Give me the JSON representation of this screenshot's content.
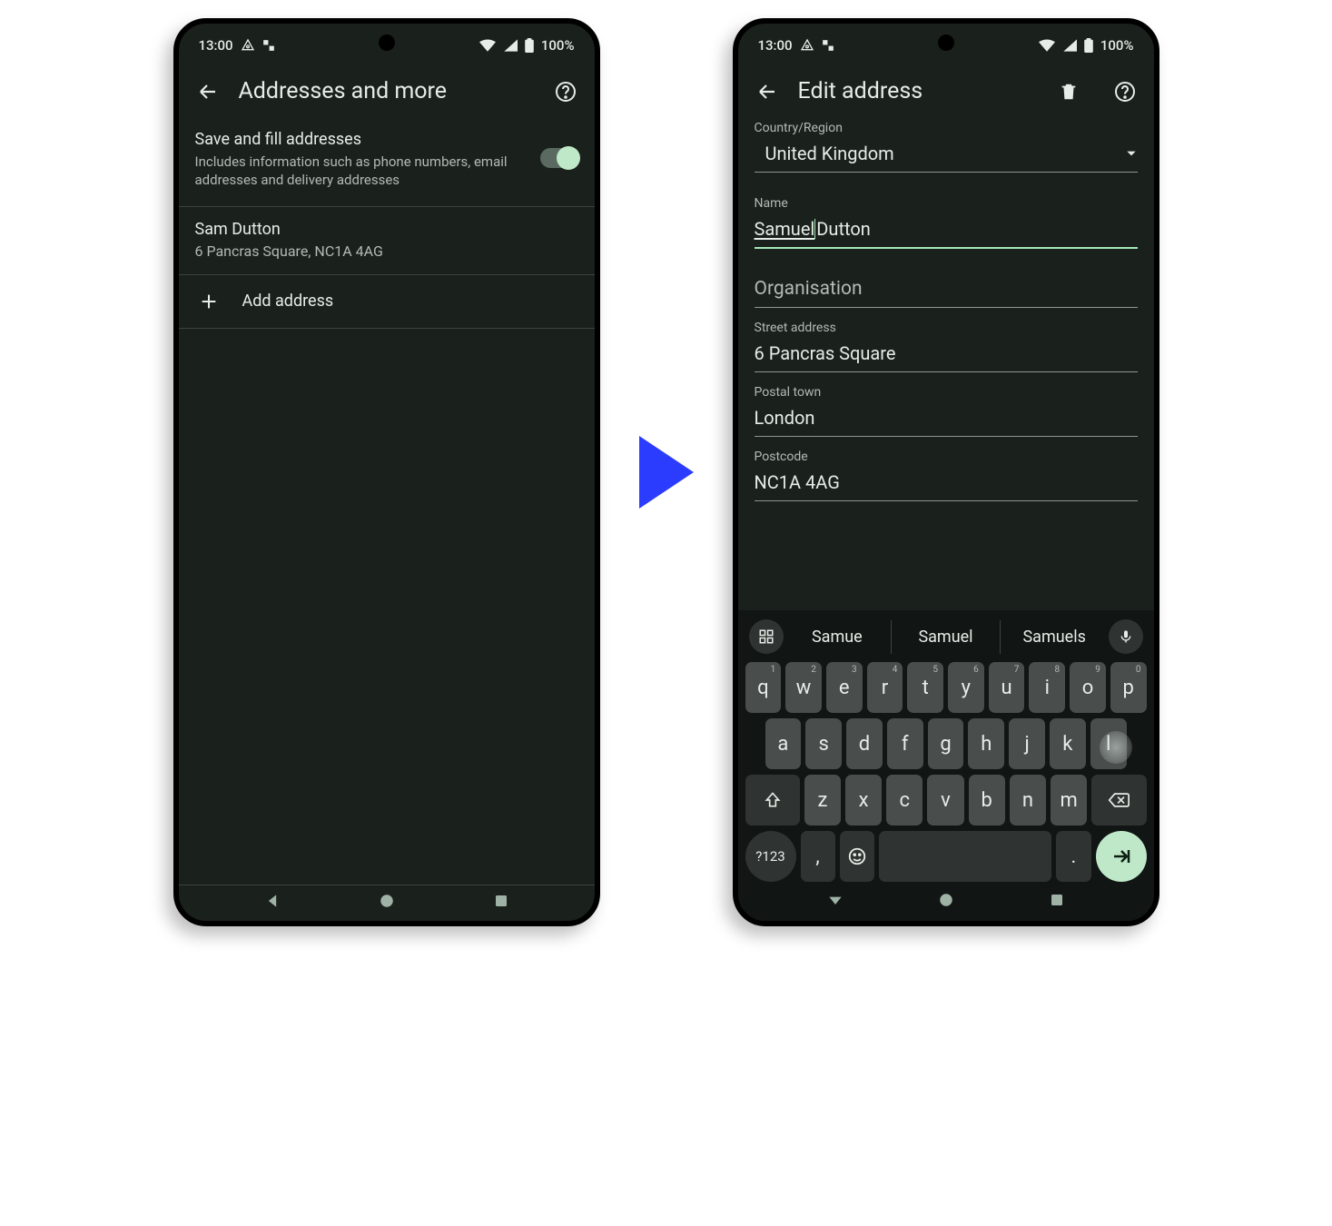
{
  "status": {
    "time": "13:00",
    "battery": "100%"
  },
  "left": {
    "title": "Addresses and more",
    "toggle_title": "Save and fill addresses",
    "toggle_sub": "Includes information such as phone numbers, email addresses and delivery addresses",
    "entry_name": "Sam Dutton",
    "entry_address": "6 Pancras Square, NC1A 4AG",
    "add_label": "Add address"
  },
  "right": {
    "title": "Edit address",
    "country_label": "Country/Region",
    "country_value": "United Kingdom",
    "name_label": "Name",
    "name_first": "Samuel",
    "name_rest": " Dutton",
    "org_label": "Organisation",
    "street_label": "Street address",
    "street_value": "6 Pancras Square",
    "town_label": "Postal town",
    "town_value": "London",
    "postcode_label": "Postcode",
    "postcode_value": "NC1A 4AG"
  },
  "keyboard": {
    "sugg": [
      "Samue",
      "Samuel",
      "Samuels"
    ],
    "row1": [
      {
        "k": "q",
        "s": "1"
      },
      {
        "k": "w",
        "s": "2"
      },
      {
        "k": "e",
        "s": "3"
      },
      {
        "k": "r",
        "s": "4"
      },
      {
        "k": "t",
        "s": "5"
      },
      {
        "k": "y",
        "s": "6"
      },
      {
        "k": "u",
        "s": "7"
      },
      {
        "k": "i",
        "s": "8"
      },
      {
        "k": "o",
        "s": "9"
      },
      {
        "k": "p",
        "s": "0"
      }
    ],
    "row2": [
      "a",
      "s",
      "d",
      "f",
      "g",
      "h",
      "j",
      "k",
      "l"
    ],
    "row3": [
      "z",
      "x",
      "c",
      "v",
      "b",
      "n",
      "m"
    ],
    "numkey": "?123",
    "comma": ",",
    "period": "."
  }
}
